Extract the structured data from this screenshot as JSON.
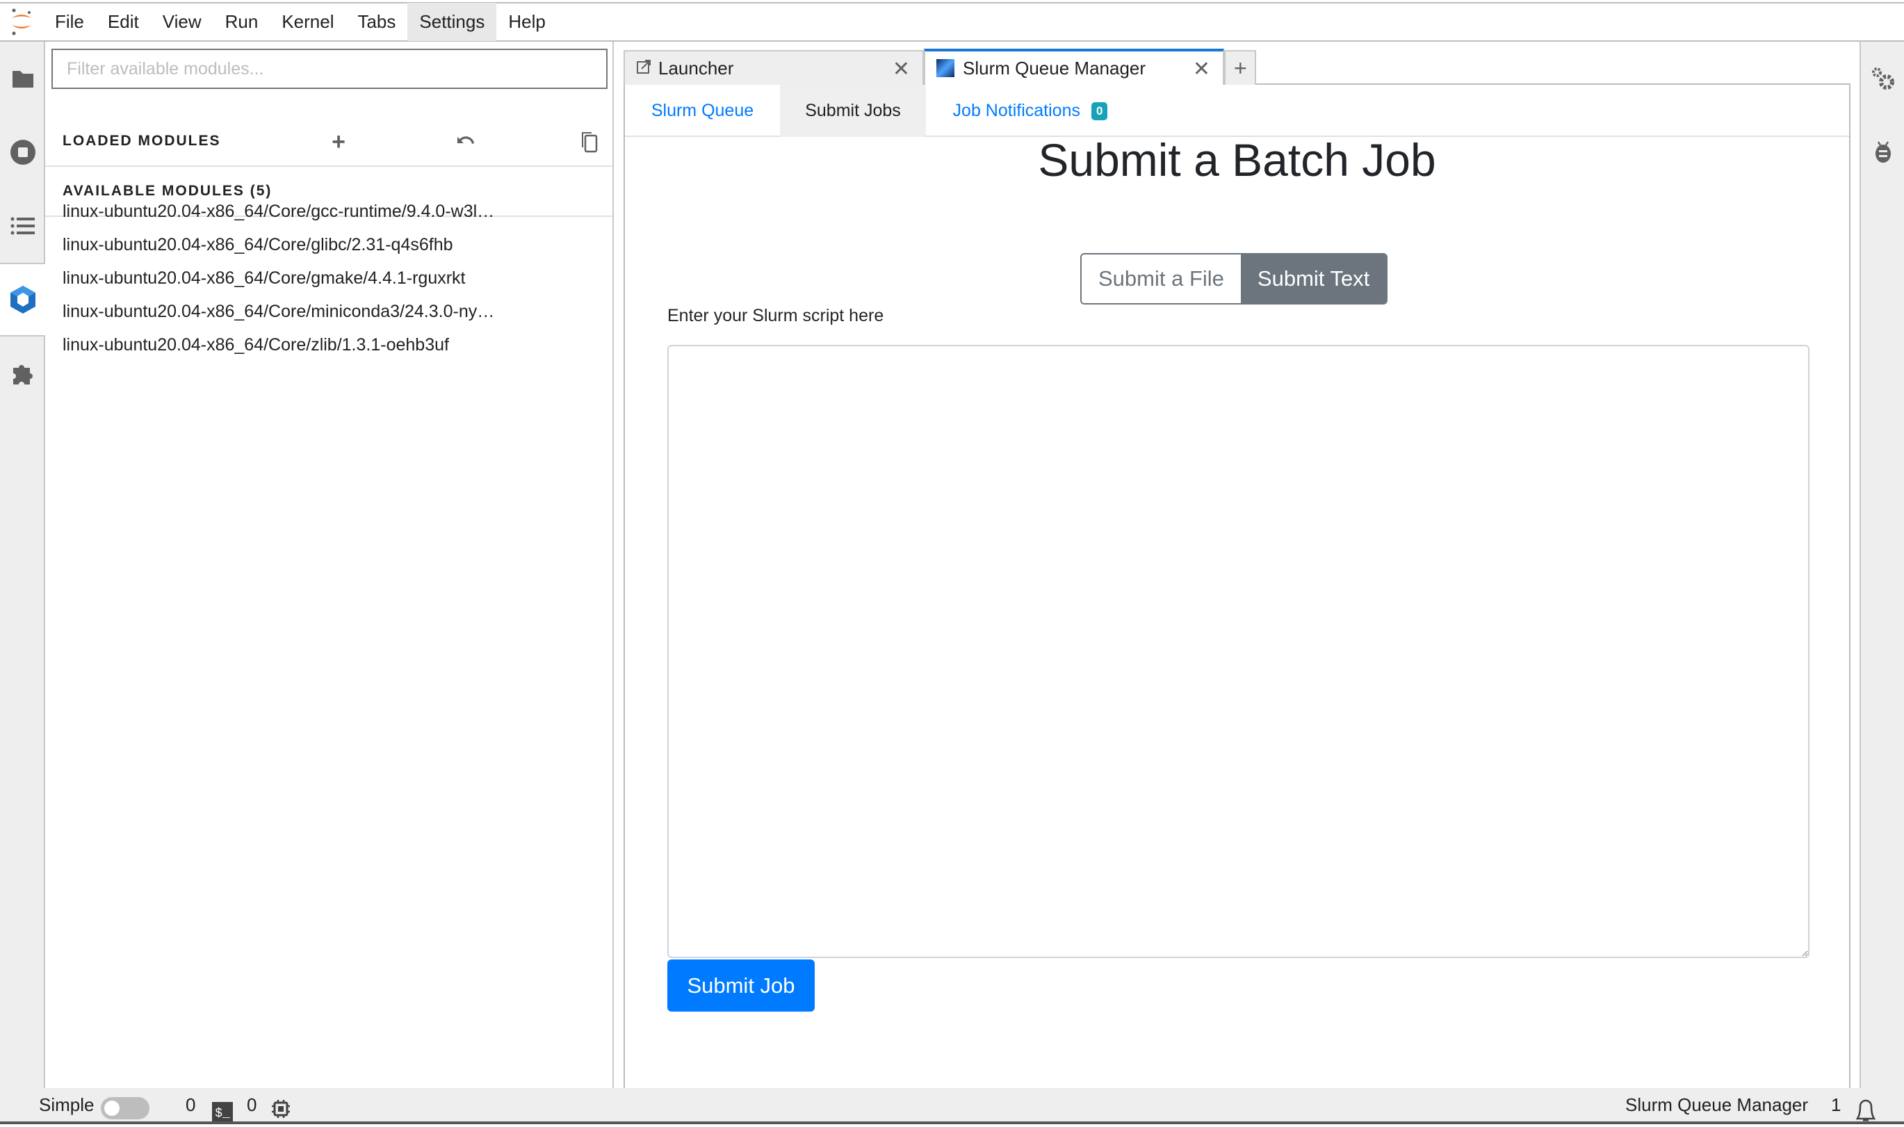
{
  "menubar": {
    "items": [
      "File",
      "Edit",
      "View",
      "Run",
      "Kernel",
      "Tabs",
      "Settings",
      "Help"
    ],
    "active": "Settings"
  },
  "left_sidebar": {
    "icons": [
      "folder-icon",
      "running-icon",
      "toc-icon",
      "modules-icon",
      "extension-icon"
    ],
    "active": "modules-icon"
  },
  "right_sidebar": {
    "icons": [
      "property-inspector-icon",
      "debugger-icon"
    ]
  },
  "modules_panel": {
    "filter": {
      "placeholder": "Filter available modules...",
      "value": ""
    },
    "loaded_header": "LOADED MODULES",
    "loaded_actions": [
      "add-icon",
      "restore-icon",
      "copy-icon"
    ],
    "available_header": "AVAILABLE MODULES (5)",
    "available": [
      "linux-ubuntu20.04-x86_64/Core/gcc-runtime/9.4.0-w3l…",
      "linux-ubuntu20.04-x86_64/Core/glibc/2.31-q4s6fhb",
      "linux-ubuntu20.04-x86_64/Core/gmake/4.4.1-rguxrkt",
      "linux-ubuntu20.04-x86_64/Core/miniconda3/24.3.0-ny…",
      "linux-ubuntu20.04-x86_64/Core/zlib/1.3.1-oehb3uf"
    ]
  },
  "doc_tabs": [
    {
      "label": "Launcher",
      "active": false
    },
    {
      "label": "Slurm Queue Manager",
      "active": true
    }
  ],
  "add_tab_label": "+",
  "slurm": {
    "tabs": [
      {
        "label": "Slurm Queue"
      },
      {
        "label": "Submit Jobs",
        "active": true
      },
      {
        "label": "Job Notifications",
        "badge": "0"
      }
    ],
    "title": "Submit a Batch Job",
    "mode_options": [
      "Submit a File",
      "Submit Text"
    ],
    "mode_selected": "Submit Text",
    "script_label": "Enter your Slurm script here",
    "script_value": "",
    "submit_label": "Submit Job",
    "colors": {
      "primary": "#007bff",
      "secondary": "#6c757d",
      "badge": "#17a2b8"
    }
  },
  "statusbar": {
    "mode_label": "Simple",
    "simple_mode": false,
    "terminals": "0",
    "kernels": "0",
    "activity": "Slurm Queue Manager",
    "notifications": "1"
  }
}
